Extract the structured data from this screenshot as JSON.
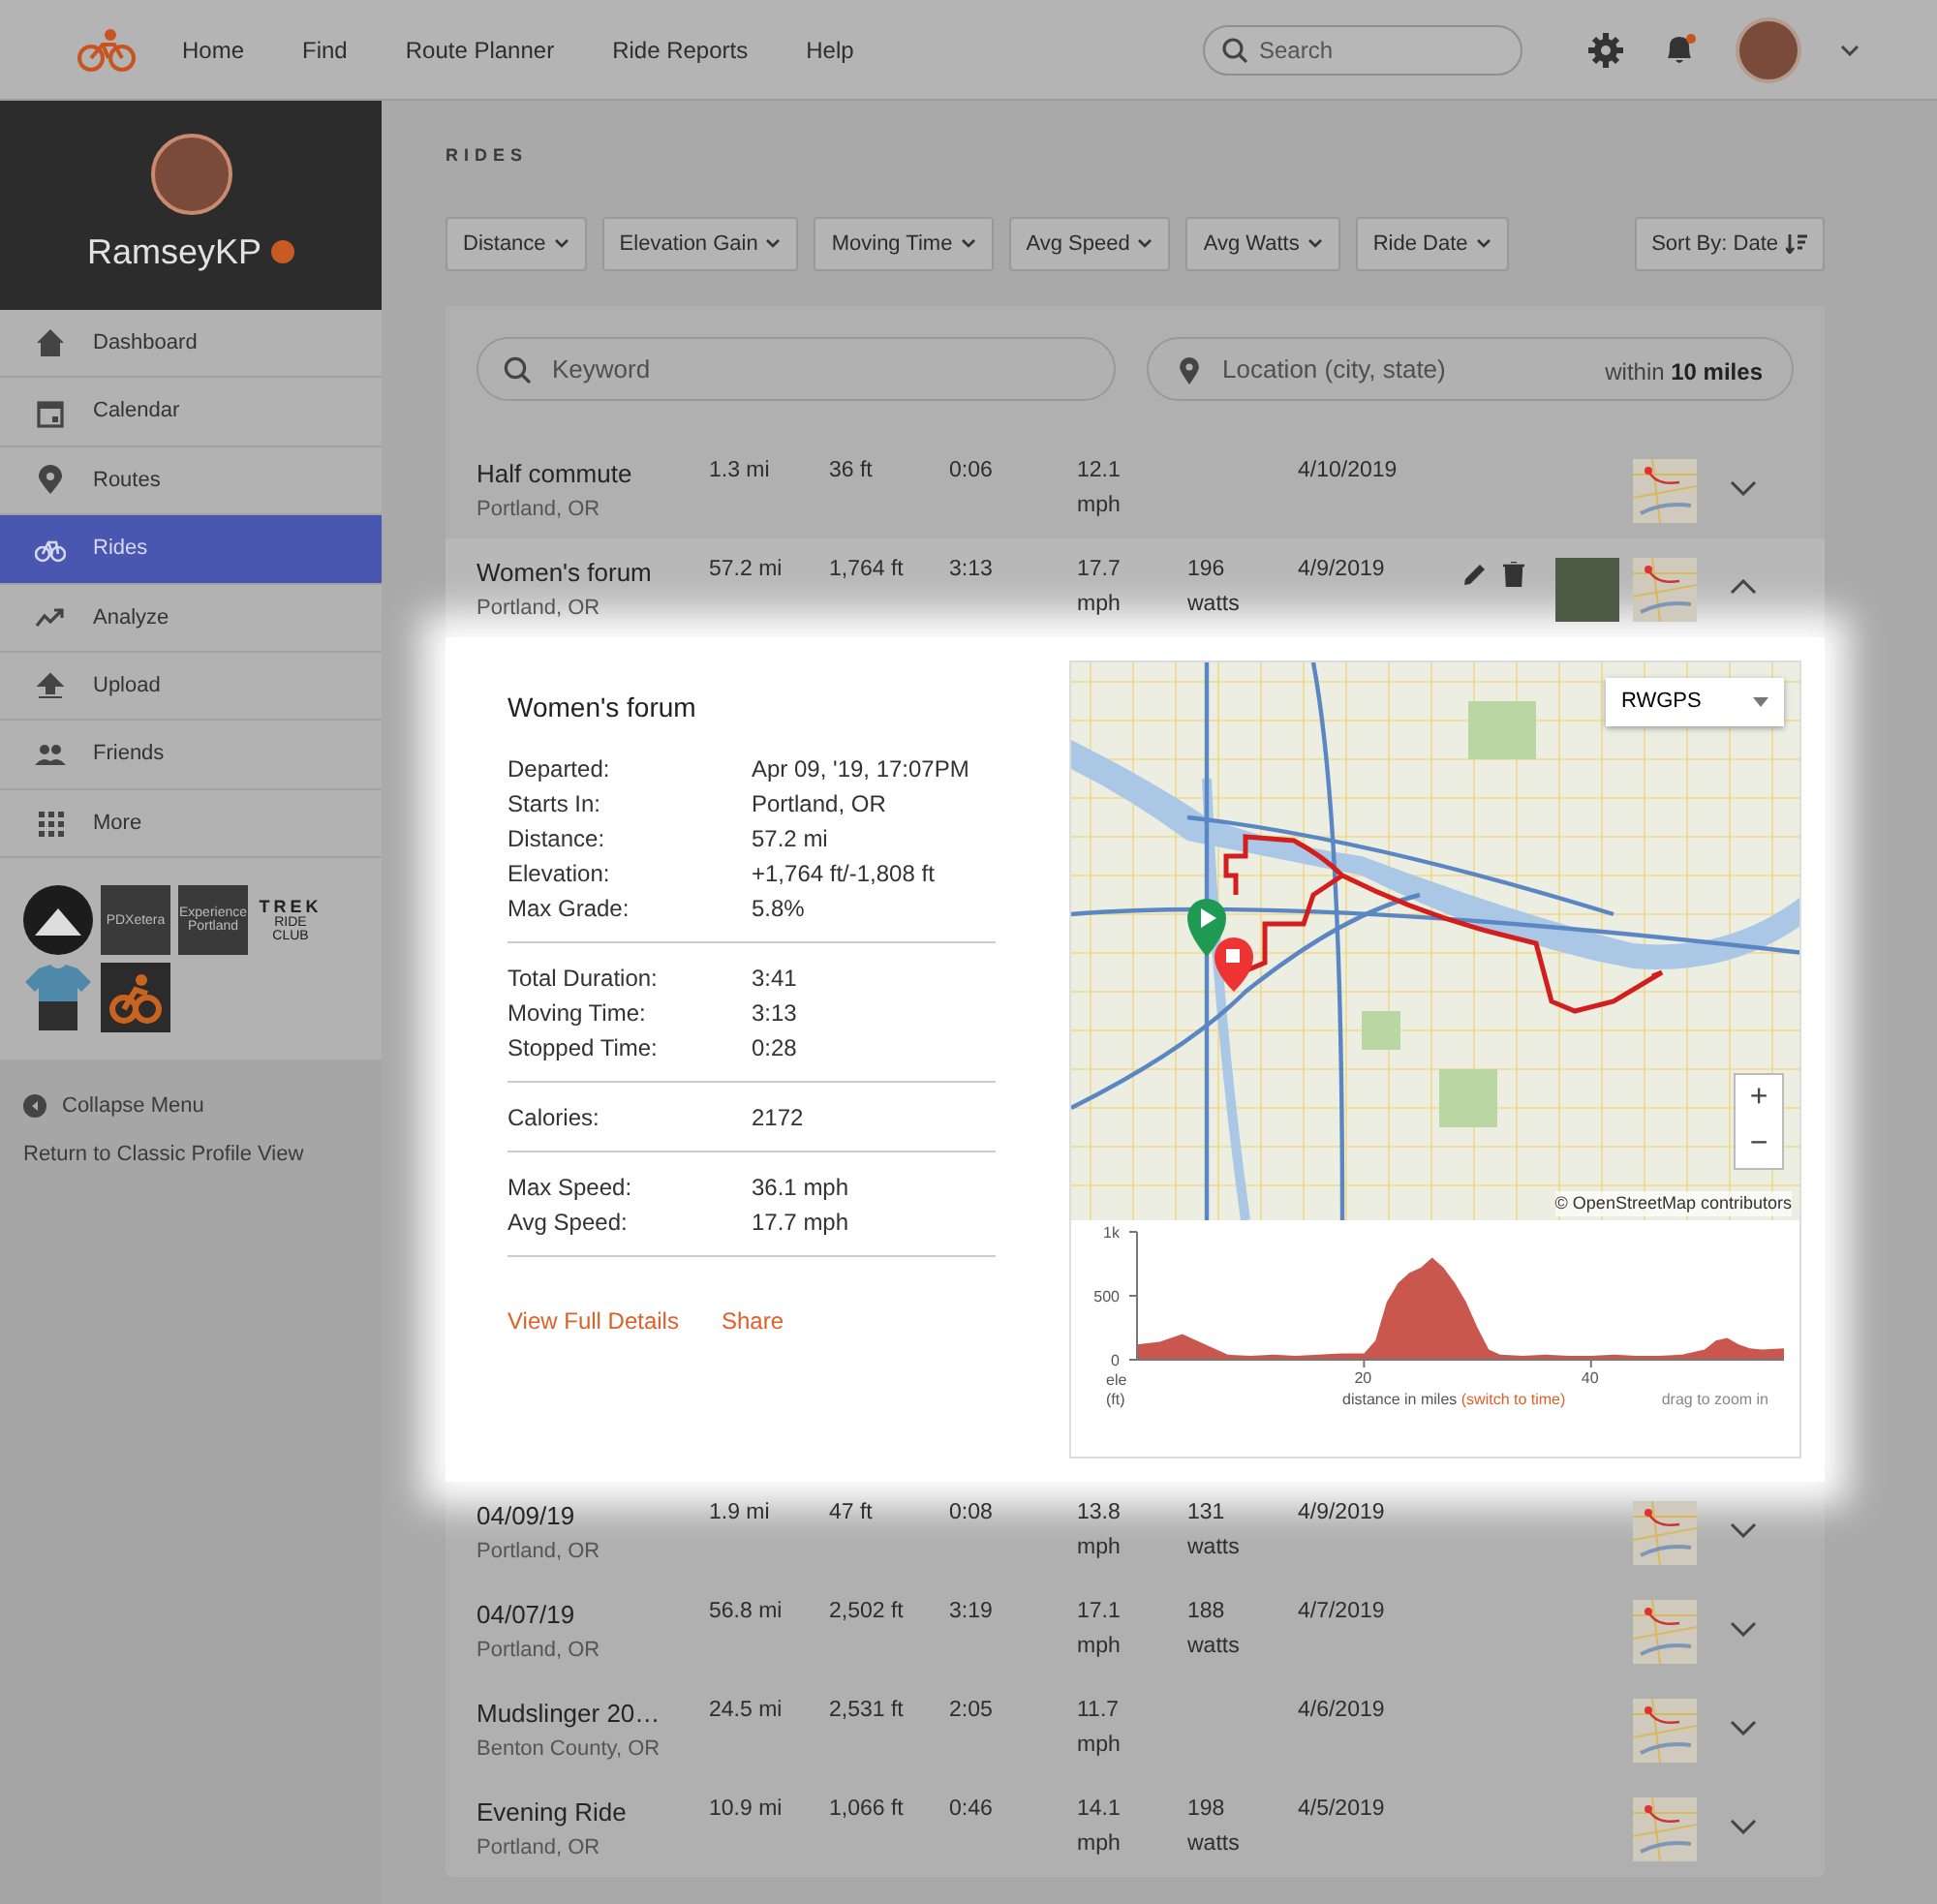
{
  "navbar": {
    "links": [
      "Home",
      "Find",
      "Route Planner",
      "Ride Reports",
      "Help"
    ],
    "search": {
      "placeholder": "Search"
    },
    "notification_unread": true
  },
  "profile": {
    "username": "RamseyKP"
  },
  "sidebar": {
    "items": [
      {
        "label": "Dashboard",
        "selected": false
      },
      {
        "label": "Calendar",
        "selected": false
      },
      {
        "label": "Routes",
        "selected": false
      },
      {
        "label": "Rides",
        "selected": true
      },
      {
        "label": "Analyze",
        "selected": false
      },
      {
        "label": "Upload",
        "selected": false
      },
      {
        "label": "Friends",
        "selected": false
      },
      {
        "label": "More",
        "selected": false
      }
    ],
    "clubs": [
      {
        "kind": "circle"
      },
      {
        "kind": "text",
        "text": "PDXetera"
      },
      {
        "kind": "text",
        "text": "Experience Portland"
      },
      {
        "kind": "trek",
        "text": "TREK",
        "subtext": "RIDE CLUB"
      },
      {
        "kind": "jersey"
      },
      {
        "kind": "rider"
      }
    ],
    "collapse": "Collapse Menu",
    "classic_link": "Return to Classic Profile View"
  },
  "page_title": "RIDES",
  "filters": [
    "Distance",
    "Elevation Gain",
    "Moving Time",
    "Avg Speed",
    "Avg Watts",
    "Ride Date"
  ],
  "sort": "Sort By: Date",
  "keyword": {
    "placeholder": "Keyword"
  },
  "location": {
    "placeholder": "Location (city, state)",
    "within": "within",
    "radius": "10 miles"
  },
  "rides": [
    {
      "name": "Half commute",
      "location": "Portland, OR",
      "distance": "1.3 mi",
      "elevation": "36 ft",
      "time": "0:06",
      "speed": "12.1 mph",
      "date": "4/10/2019",
      "photo": false,
      "expanded": false
    },
    {
      "name": "Women's forum",
      "location": "Portland, OR",
      "distance": "57.2 mi",
      "elevation": "1,764 ft",
      "time": "3:13",
      "speed": "17.7 mph",
      "watts": "196 watts",
      "date": "4/9/2019",
      "photo": true,
      "expanded": true,
      "details": {
        "title": "Women's forum",
        "groups": [
          [
            {
              "label": "Departed:",
              "value": "Apr 09, '19, 17:07PM"
            },
            {
              "label": "Starts In:",
              "value": "Portland, OR"
            },
            {
              "label": "Distance:",
              "value": "57.2 mi"
            },
            {
              "label": "Elevation:",
              "value": "+1,764 ft/-1,808 ft"
            },
            {
              "label": "Max Grade:",
              "value": "5.8%"
            }
          ],
          [
            {
              "label": "Total Duration:",
              "value": "3:41"
            },
            {
              "label": "Moving Time:",
              "value": "3:13"
            },
            {
              "label": "Stopped Time:",
              "value": "0:28"
            }
          ],
          [
            {
              "label": "Calories:",
              "value": "2172"
            }
          ],
          [
            {
              "label": "Max Speed:",
              "value": "36.1 mph"
            },
            {
              "label": "Avg Speed:",
              "value": "17.7 mph"
            }
          ]
        ],
        "links": [
          "View Full Details",
          "Share"
        ],
        "map": {
          "layer": "RWGPS",
          "attribution": "© OpenStreetMap contributors",
          "zoom_in": "+",
          "zoom_out": "−"
        },
        "elevation": {
          "switch_link": "(switch to time)",
          "hint": "drag to zoom in",
          "chart_data": {
            "type": "area",
            "xlabel": "distance in miles",
            "ylabel": "ele (ft)",
            "x": [
              0,
              2,
              4,
              6,
              8,
              10,
              12,
              14,
              16,
              18,
              20,
              21,
              22,
              23,
              24,
              25,
              26,
              27,
              28,
              29,
              30,
              31,
              32,
              34,
              36,
              38,
              40,
              42,
              44,
              46,
              48,
              50,
              51,
              52,
              53,
              54,
              55,
              57
            ],
            "values": [
              120,
              140,
              200,
              120,
              40,
              30,
              40,
              30,
              40,
              50,
              50,
              150,
              450,
              600,
              680,
              720,
              800,
              720,
              600,
              450,
              250,
              80,
              40,
              30,
              40,
              30,
              30,
              40,
              30,
              30,
              40,
              80,
              150,
              170,
              120,
              90,
              80,
              90
            ],
            "xlim": [
              0,
              57
            ],
            "ylim": [
              0,
              1000
            ],
            "xticks": [
              20,
              40
            ],
            "yticks": [
              0,
              500,
              {
                "value": 1000,
                "label": "1k"
              }
            ]
          }
        }
      }
    },
    {
      "name": "04/09/19",
      "location": "Portland, OR",
      "distance": "1.9 mi",
      "elevation": "47 ft",
      "time": "0:08",
      "speed": "13.8 mph",
      "watts": "131 watts",
      "date": "4/9/2019",
      "photo": false,
      "expanded": false
    },
    {
      "name": "04/07/19",
      "location": "Portland, OR",
      "distance": "56.8 mi",
      "elevation": "2,502 ft",
      "time": "3:19",
      "speed": "17.1 mph",
      "watts": "188 watts",
      "date": "4/7/2019",
      "photo": false,
      "expanded": false
    },
    {
      "name": "Mudslinger 20…",
      "location": "Benton County, OR",
      "distance": "24.5 mi",
      "elevation": "2,531 ft",
      "time": "2:05",
      "speed": "11.7 mph",
      "date": "4/6/2019",
      "photo": false,
      "expanded": false
    },
    {
      "name": "Evening Ride",
      "location": "Portland, OR",
      "distance": "10.9 mi",
      "elevation": "1,066 ft",
      "time": "0:46",
      "speed": "14.1 mph",
      "watts": "198 watts",
      "date": "4/5/2019",
      "photo": false,
      "expanded": false
    }
  ]
}
